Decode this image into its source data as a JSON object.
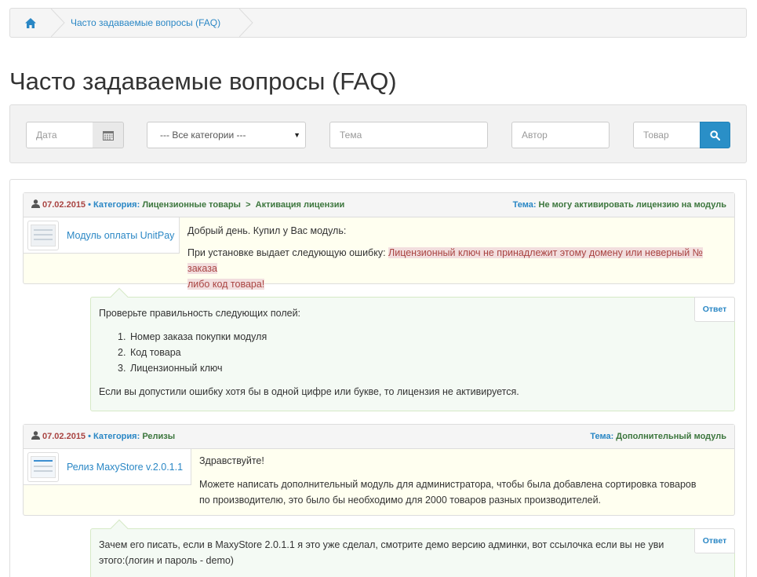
{
  "breadcrumb": {
    "home_icon": "home-icon",
    "current": "Часто задаваемые вопросы (FAQ)"
  },
  "page": {
    "title": "Часто задаваемые вопросы (FAQ)"
  },
  "filters": {
    "date_placeholder": "Дата",
    "date_icon": "calendar-icon",
    "category_selected": "--- Все категории ---",
    "topic_placeholder": "Тема",
    "author_placeholder": "Автор",
    "product_placeholder": "Товар",
    "search_icon": "search-icon"
  },
  "questions": [
    {
      "user_icon": "user-icon",
      "date": "07.02.2015",
      "category_label": "Категория:",
      "category": "Лицензионные товары",
      "subcategory_sep": ">",
      "subcategory": "Активация лицензии",
      "topic_label": "Тема:",
      "topic": "Не могу активировать лицензию на модуль",
      "product": "Модуль оплаты UnitPay",
      "text_lines": [
        "Добрый день. Купил у Вас модуль:",
        "При установке выдает следующую ошибку: "
      ],
      "highlight_1": "Лицензионный ключ не принадлежит этому домену или неверный № заказа",
      "highlight_2": "либо код товара!",
      "answer": {
        "tag": "Ответ",
        "intro": "Проверьте правильность следующих полей:",
        "items": [
          "Номер заказа покупки модуля",
          "Код товара",
          "Лицензионный ключ"
        ],
        "outro": "Если вы допустили ошибку хотя бы в одной цифре или букве, то лицензия не активируется."
      }
    },
    {
      "user_icon": "user-icon",
      "date": "07.02.2015",
      "category_label": "Категория:",
      "category": "Релизы",
      "topic_label": "Тема:",
      "topic": "Дополнительный модуль",
      "product": "Релиз MaxyStore v.2.0.1.1",
      "greeting": "Здравствуйте!",
      "line_1": "Можете написать дополнительный модуль для администратора, чтобы была добавлена сортировка товаров",
      "line_2": "по производителю, это было бы необходимо для 2000 товаров разных производителей.",
      "answer": {
        "tag": "Ответ",
        "line_1": "Зачем его писать, если в MaxyStore 2.0.1.1 я это уже сделал, смотрите демо версию админки, вот ссылочка если вы не уви",
        "line_2": "этого:(логин и пароль - demo)"
      }
    }
  ],
  "colors": {
    "link": "#2a87c5",
    "date": "#a94442",
    "category_value": "#3c763d",
    "search_button": "#2a8fc7",
    "question_bg": "#fffff0",
    "answer_bg": "#f4faf4",
    "highlight_bg": "#f2dede"
  }
}
